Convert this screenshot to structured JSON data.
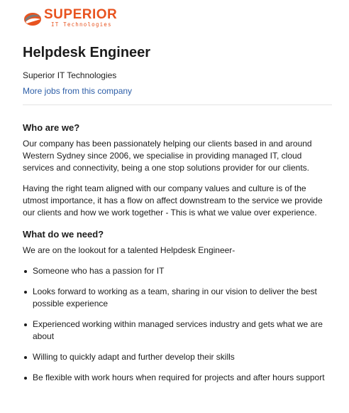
{
  "logo": {
    "name": "SUPERIOR",
    "subtitle": "IT Technologies",
    "brand_color": "#e8531f",
    "icon": "superior-swirl-logo"
  },
  "job": {
    "title": "Helpdesk Engineer",
    "company": "Superior IT Technologies",
    "more_jobs_link": "More jobs from this company"
  },
  "who": {
    "heading": "Who are we?",
    "para1": "Our company has been passionately helping our clients based in and around Western Sydney since 2006, we specialise in providing managed IT, cloud services and connectivity, being a one stop solutions provider for our clients.",
    "para2": "Having the right team aligned with our company values and culture is of the utmost importance, it has a flow on affect downstream to the service we provide our clients and how we work together - This is what we value over experience."
  },
  "need": {
    "heading": "What do we need?",
    "intro": "We are on the lookout for a talented Helpdesk Engineer-",
    "items": [
      "Someone who has a passion for IT",
      "Looks forward to working as a team, sharing in our vision to deliver the best possible experience",
      "Experienced working within managed services industry and gets what we are about",
      "Willing to quickly adapt and further develop their skills",
      "Be flexible with work hours when required for projects and after hours support"
    ]
  },
  "colors": {
    "link": "#2e5fa8",
    "text": "#1c1c1c",
    "divider": "#e3e3e3"
  }
}
